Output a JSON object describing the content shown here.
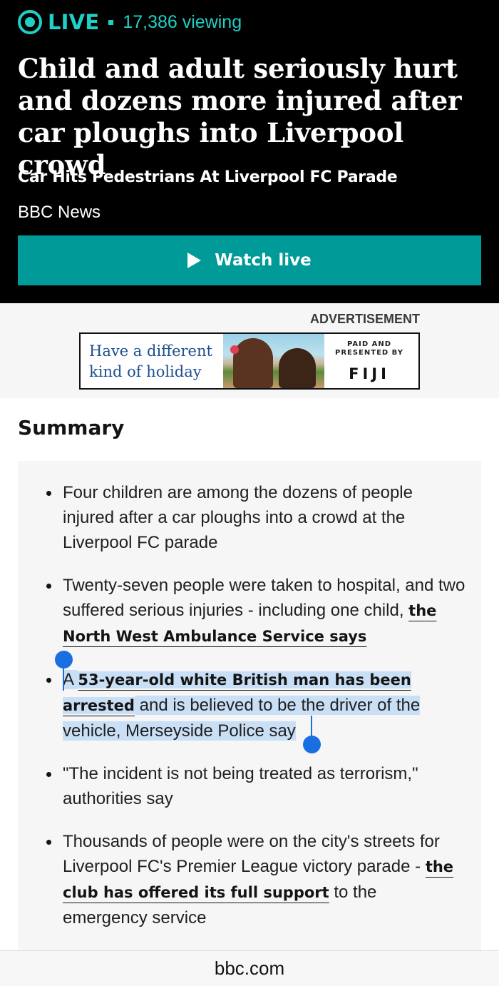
{
  "live": {
    "label": "LIVE",
    "viewers": "17,386 viewing"
  },
  "headline": "Child and adult seriously hurt and dozens more injured after car ploughs into Liverpool crowd",
  "subheadline": "Car Hits Pedestrians At Liverpool FC Parade",
  "source": "BBC News",
  "watch_button": {
    "label": "Watch live"
  },
  "ad": {
    "label": "ADVERTISEMENT",
    "tagline_line1": "Have a different",
    "tagline_line2": "kind of holiday",
    "paid_line1": "PAID AND",
    "paid_line2": "PRESENTED BY",
    "brand": "FIJI"
  },
  "summary": {
    "title": "Summary",
    "items": [
      {
        "text": "Four children are among the dozens of people injured after a car ploughs into a crowd at the Liverpool FC parade"
      },
      {
        "text": "Twenty-seven people were taken to hospital, and two suffered serious injuries - including one child, ",
        "link": "the North West Ambulance Service says"
      },
      {
        "prefix": "A ",
        "link": "53-year-old white British man has been arrested",
        "suffix": " and is believed to be the driver of the vehicle, Merseyside Police say"
      },
      {
        "text": "\"The incident is not being treated as terrorism,\" authorities say"
      },
      {
        "text": "Thousands of people were on the city's streets for Liverpool FC's Premier League victory parade - ",
        "link": "the club has offered its full support",
        "suffix": " to the emergency service"
      }
    ]
  },
  "browser": {
    "url": "bbc.com"
  },
  "colors": {
    "live_accent": "#1fd0c6",
    "watch_button": "#009a98",
    "selection": "#c9dff6",
    "selection_handle": "#1a6fe0"
  }
}
